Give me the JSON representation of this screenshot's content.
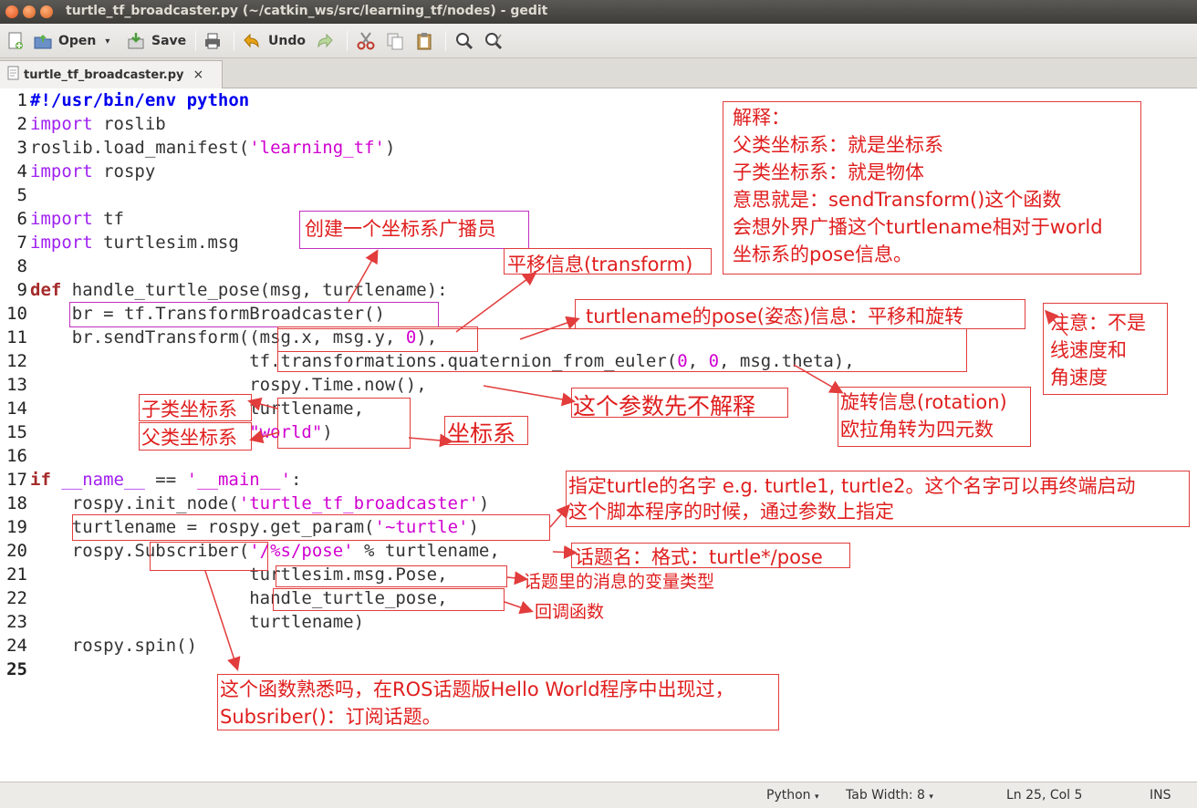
{
  "window": {
    "title": "turtle_tf_broadcaster.py (~/catkin_ws/src/learning_tf/nodes) - gedit"
  },
  "toolbar": {
    "open_label": "Open",
    "save_label": "Save",
    "undo_label": "Undo"
  },
  "tab": {
    "label": "turtle_tf_broadcaster.py",
    "close": "×"
  },
  "code": [
    {
      "n": "1",
      "parts": [
        [
          "shebang",
          "#!/usr/bin/env python"
        ]
      ]
    },
    {
      "n": "2",
      "parts": [
        [
          "kw2",
          "import"
        ],
        [
          "",
          " roslib"
        ]
      ]
    },
    {
      "n": "3",
      "parts": [
        [
          "",
          "roslib.load_manifest("
        ],
        [
          "str",
          "'learning_tf'"
        ],
        [
          "",
          ")"
        ]
      ]
    },
    {
      "n": "4",
      "parts": [
        [
          "kw2",
          "import"
        ],
        [
          "",
          " rospy"
        ]
      ]
    },
    {
      "n": "5",
      "parts": []
    },
    {
      "n": "6",
      "parts": [
        [
          "kw2",
          "import"
        ],
        [
          "",
          " tf"
        ]
      ]
    },
    {
      "n": "7",
      "parts": [
        [
          "kw2",
          "import"
        ],
        [
          "",
          " turtlesim.msg"
        ]
      ]
    },
    {
      "n": "8",
      "parts": []
    },
    {
      "n": "9",
      "parts": [
        [
          "kw",
          "def"
        ],
        [
          "",
          " handle_turtle_pose(msg, turtlename):"
        ]
      ]
    },
    {
      "n": "10",
      "parts": [
        [
          "",
          "    br = tf.TransformBroadcaster()"
        ]
      ]
    },
    {
      "n": "11",
      "parts": [
        [
          "",
          "    br.sendTransform((msg.x, msg.y, "
        ],
        [
          "num",
          "0"
        ],
        [
          "",
          "),"
        ]
      ]
    },
    {
      "n": "12",
      "parts": [
        [
          "",
          "                     tf.transformations.quaternion_from_euler("
        ],
        [
          "num",
          "0"
        ],
        [
          "",
          ", "
        ],
        [
          "num",
          "0"
        ],
        [
          "",
          ", msg.theta),"
        ]
      ]
    },
    {
      "n": "13",
      "parts": [
        [
          "",
          "                     rospy.Time.now(),"
        ]
      ]
    },
    {
      "n": "14",
      "parts": [
        [
          "",
          "                     turtlename,"
        ]
      ]
    },
    {
      "n": "15",
      "parts": [
        [
          "",
          "                     "
        ],
        [
          "str",
          "\"world\""
        ],
        [
          "",
          ")"
        ]
      ]
    },
    {
      "n": "16",
      "parts": []
    },
    {
      "n": "17",
      "parts": [
        [
          "kw",
          "if"
        ],
        [
          "",
          " "
        ],
        [
          "kw2",
          "__name__"
        ],
        [
          "",
          " == "
        ],
        [
          "str",
          "'__main__'"
        ],
        [
          "",
          ":"
        ]
      ]
    },
    {
      "n": "18",
      "parts": [
        [
          "",
          "    rospy.init_node("
        ],
        [
          "str",
          "'turtle_tf_broadcaster'"
        ],
        [
          "",
          ")"
        ]
      ]
    },
    {
      "n": "19",
      "parts": [
        [
          "",
          "    turtlename = rospy.get_param("
        ],
        [
          "str",
          "'~turtle'"
        ],
        [
          "",
          ")"
        ]
      ]
    },
    {
      "n": "20",
      "parts": [
        [
          "",
          "    rospy.Subscriber("
        ],
        [
          "str",
          "'/%s/pose'"
        ],
        [
          "",
          " % turtlename,"
        ]
      ]
    },
    {
      "n": "21",
      "parts": [
        [
          "",
          "                     turtlesim.msg.Pose,"
        ]
      ]
    },
    {
      "n": "22",
      "parts": [
        [
          "",
          "                     handle_turtle_pose,"
        ]
      ]
    },
    {
      "n": "23",
      "parts": [
        [
          "",
          "                     turtlename)"
        ]
      ]
    },
    {
      "n": "24",
      "parts": [
        [
          "",
          "    rospy.spin()"
        ]
      ]
    },
    {
      "n": "25",
      "parts": []
    }
  ],
  "annotations": {
    "explain": [
      "解释：",
      "父类坐标系：就是坐标系",
      "子类坐标系：就是物体",
      "意思就是：sendTransform()这个函数",
      "会想外界广播这个turtlename相对于world",
      "坐标系的pose信息。"
    ],
    "broadcaster": "创建一个坐标系广播员",
    "translation": "平移信息(transform)",
    "pose_info": "turtlename的pose(姿态)信息：平移和旋转",
    "notice": [
      "注意：不是",
      "线速度和",
      "角速度"
    ],
    "param_skip": "这个参数先不解释",
    "rotation": [
      "旋转信息(rotation)",
      "欧拉角转为四元数"
    ],
    "child_frame": "子类坐标系",
    "parent_frame": "父类坐标系",
    "frame": "坐标系",
    "turtle_name": [
      "指定turtle的名字 e.g. turtle1, turtle2。这个名字可以再终端启动",
      "这个脚本程序的时候，通过参数上指定"
    ],
    "topic_name": "话题名：格式：turtle*/pose",
    "msg_type": "话题里的消息的变量类型",
    "callback": "回调函数",
    "subscriber": [
      "这个函数熟悉吗，在ROS话题版Hello World程序中出现过，",
      "Subsriber()：订阅话题。"
    ]
  },
  "status": {
    "language": "Python",
    "tab_width": "Tab Width: 8",
    "position": "Ln 25, Col 5",
    "mode": "INS"
  }
}
